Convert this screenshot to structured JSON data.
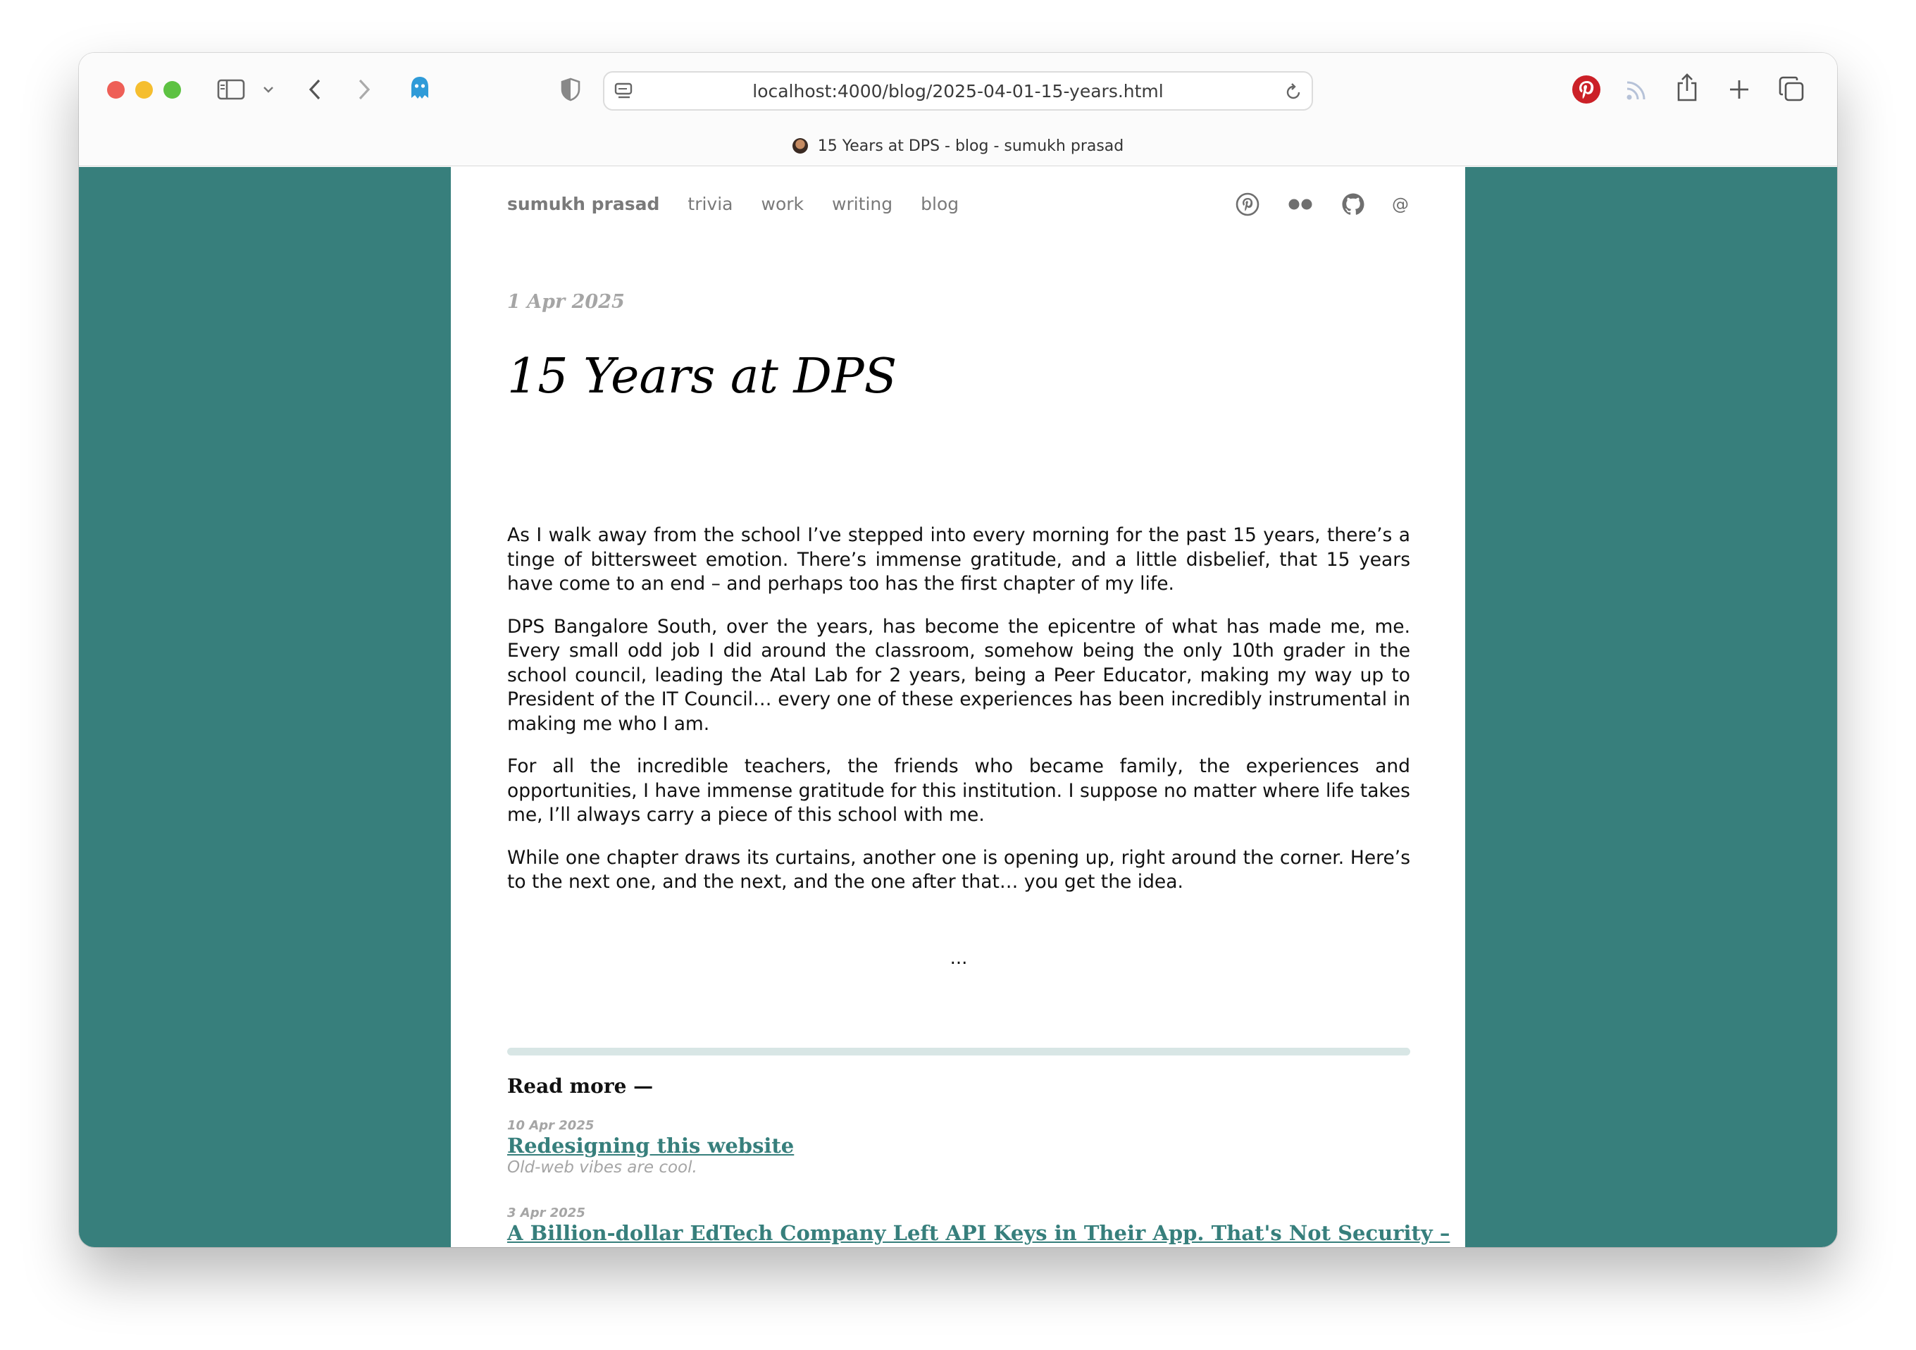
{
  "browser": {
    "url": "localhost:4000/blog/2025-04-01-15-years.html",
    "tab_title": "15 Years at DPS - blog - sumukh prasad"
  },
  "site": {
    "brand": "sumukh prasad",
    "nav": [
      "trivia",
      "work",
      "writing",
      "blog"
    ],
    "social": [
      "pinterest-icon",
      "flickr-icon",
      "github-icon",
      "email-icon"
    ],
    "email_glyph": "@"
  },
  "post": {
    "date": "1 Apr 2025",
    "title": "15 Years at DPS",
    "paragraphs": [
      "As I walk away from the school I’ve stepped into every morning for the past 15 years, there’s a tinge of bittersweet emotion. There’s immense gratitude, and a little disbelief, that 15 years have come to an end – and perhaps too has the first chapter of my life.",
      "DPS Bangalore South, over the years, has become the epicentre of what has made me, me. Every small odd job I did around the classroom, somehow being the only 10th grader in the school council, leading the Atal Lab for 2 years, being a Peer Educator, making my way up to President of the IT Council… every one of these experiences has been incredibly instrumental in making me who I am.",
      "For all the incredible teachers, the friends who became family, the experiences and opportunities, I have immense gratitude for this institution. I suppose no matter where life takes me, I’ll always carry a piece of this school with me.",
      "While one chapter draws its curtains, another one is opening up, right around the corner. Here’s to the next one, and the next, and the one after that… you get the idea."
    ],
    "ellipsis": "..."
  },
  "read_more": {
    "heading": "Read more —",
    "items": [
      {
        "date": "10 Apr 2025",
        "title": "Redesigning this website",
        "subtitle": "Old-web vibes are cool."
      },
      {
        "date": "3 Apr 2025",
        "title": "A Billion-dollar EdTech Company Left API Keys in Their App. That's Not Security –",
        "subtitle": ""
      }
    ]
  },
  "colors": {
    "teal": "#377f7c",
    "muted": "#a5a5a5"
  }
}
